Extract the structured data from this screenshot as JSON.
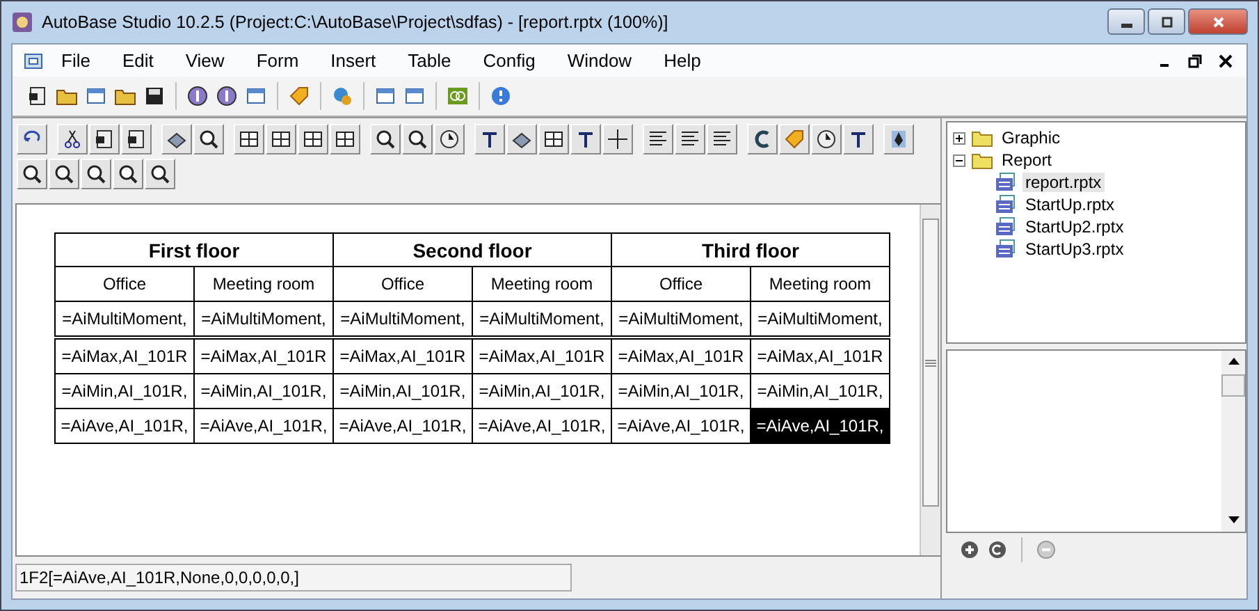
{
  "window": {
    "title": "AutoBase Studio 10.2.5 (Project:C:\\AutoBase\\Project\\sdfas) - [report.rptx (100%)]"
  },
  "menu": [
    "File",
    "Edit",
    "View",
    "Form",
    "Insert",
    "Table",
    "Config",
    "Window",
    "Help"
  ],
  "report_table": {
    "groups": [
      "First floor",
      "Second floor",
      "Third floor"
    ],
    "columns": [
      "Office",
      "Meeting room",
      "Office",
      "Meeting room",
      "Office",
      "Meeting room"
    ],
    "rows": [
      [
        {
          "text": "=AiMultiMoment,",
          "selected": false
        },
        {
          "text": "=AiMultiMoment,",
          "selected": false
        },
        {
          "text": "=AiMultiMoment,",
          "selected": false
        },
        {
          "text": "=AiMultiMoment,",
          "selected": false
        },
        {
          "text": "=AiMultiMoment,",
          "selected": false
        },
        {
          "text": "=AiMultiMoment,",
          "selected": false
        }
      ],
      [
        {
          "text": "=AiMax,AI_101R",
          "selected": false
        },
        {
          "text": "=AiMax,AI_101R",
          "selected": false
        },
        {
          "text": "=AiMax,AI_101R",
          "selected": false
        },
        {
          "text": "=AiMax,AI_101R",
          "selected": false
        },
        {
          "text": "=AiMax,AI_101R",
          "selected": false
        },
        {
          "text": "=AiMax,AI_101R",
          "selected": false
        }
      ],
      [
        {
          "text": "=AiMin,AI_101R,",
          "selected": false
        },
        {
          "text": "=AiMin,AI_101R,",
          "selected": false
        },
        {
          "text": "=AiMin,AI_101R,",
          "selected": false
        },
        {
          "text": "=AiMin,AI_101R,",
          "selected": false
        },
        {
          "text": "=AiMin,AI_101R,",
          "selected": false
        },
        {
          "text": "=AiMin,AI_101R,",
          "selected": false
        }
      ],
      [
        {
          "text": "=AiAve,AI_101R,",
          "selected": false
        },
        {
          "text": "=AiAve,AI_101R,",
          "selected": false
        },
        {
          "text": "=AiAve,AI_101R,",
          "selected": false
        },
        {
          "text": "=AiAve,AI_101R,",
          "selected": false
        },
        {
          "text": "=AiAve,AI_101R,",
          "selected": false
        },
        {
          "text": "=AiAve,AI_101R,",
          "selected": true
        }
      ]
    ]
  },
  "cell_formula": {
    "value": "1F2[=AiAve,AI_101R,None,0,0,0,0,0,]"
  },
  "project_tree": [
    {
      "label": "Graphic",
      "expanded": false,
      "selected": false
    },
    {
      "label": "Report",
      "expanded": true,
      "selected": false,
      "children": [
        {
          "label": "report.rptx",
          "selected": true
        },
        {
          "label": "StartUp.rptx",
          "selected": false
        },
        {
          "label": "StartUp2.rptx",
          "selected": false
        },
        {
          "label": "StartUp3.rptx",
          "selected": false
        }
      ]
    }
  ]
}
